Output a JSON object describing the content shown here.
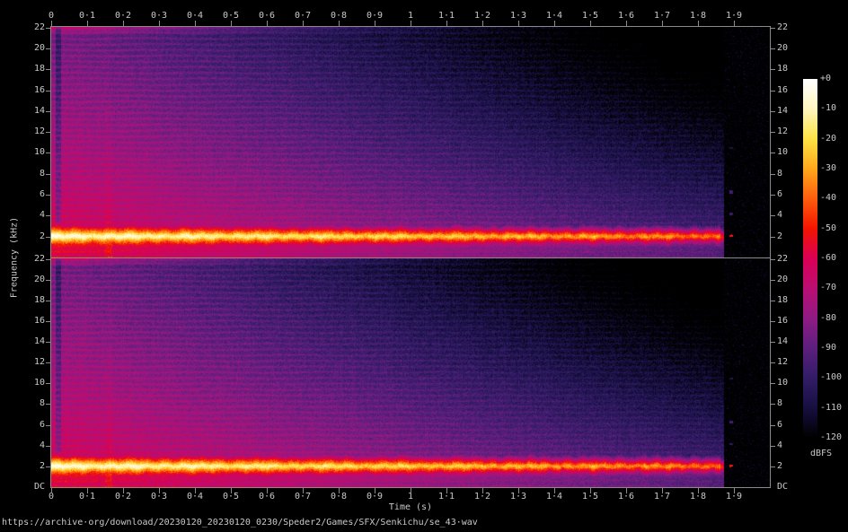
{
  "source_url": "https://archive·org/download/20230120_20230120_0230/Speder2/Games/SFX/Senkichu/se_43·wav",
  "axes": {
    "time": {
      "label": "Time (s)",
      "tick_labels": [
        "0",
        "0·1",
        "0·2",
        "0·3",
        "0·4",
        "0·5",
        "0·6",
        "0·7",
        "0·8",
        "0·9",
        "1",
        "1·1",
        "1·2",
        "1·3",
        "1·4",
        "1·5",
        "1·6",
        "1·7",
        "1·8",
        "1·9"
      ]
    },
    "frequency": {
      "label": "Frequency (kHz)",
      "tick_labels": [
        "22",
        "20",
        "18",
        "16",
        "14",
        "12",
        "10",
        "8",
        "6",
        "4",
        "2"
      ],
      "dc_label": "DC"
    },
    "colorbar": {
      "label": "dBFS",
      "tick_labels": [
        "+0",
        "-10",
        "-20",
        "-30",
        "-40",
        "-50",
        "-60",
        "-70",
        "-80",
        "-90",
        "-100",
        "-110",
        "-120"
      ]
    }
  },
  "chart_data": {
    "type": "heatmap",
    "subtype": "stereo audio spectrogram, two stacked channel panels (SoX style)",
    "x": {
      "label": "Time (s)",
      "range_s": [
        0,
        2.0
      ],
      "tick_step_s": 0.1
    },
    "y": {
      "label": "Frequency (kHz)",
      "range_khz_per_channel": [
        0,
        22.05
      ],
      "tick_step_khz": 2,
      "dc_at_bottom": true
    },
    "z": {
      "label": "dBFS",
      "range_db": [
        -120,
        0
      ],
      "tick_step_db": 10,
      "legend_position": "right colorbar"
    },
    "channels": 2,
    "features": {
      "dominant_tone_khz": 2.06,
      "dominant_tone_level_dbfs_start": -5,
      "dominant_tone_level_dbfs_end": -40,
      "signal_end_s": 1.87,
      "echo_dot_s": 1.89,
      "harmonic_stripe_spacing_khz": 0.55,
      "secondary_partial_khz": 6.3,
      "onset_attack_s": 0.0,
      "second_burst_s": 0.16,
      "broadband_floor_dbfs_at_start": -60,
      "broadband_floor_dbfs_at_end": -115,
      "top_edge_emphasis_khz": 22.0
    },
    "palette_stops": [
      [
        0.0,
        "#ffffff"
      ],
      [
        0.083,
        "#fff6c0"
      ],
      [
        0.167,
        "#ffe345"
      ],
      [
        0.25,
        "#ffa81c"
      ],
      [
        0.333,
        "#ff5e0d"
      ],
      [
        0.417,
        "#f21500"
      ],
      [
        0.5,
        "#da0055"
      ],
      [
        0.583,
        "#bb0e72"
      ],
      [
        0.667,
        "#8e1b84"
      ],
      [
        0.75,
        "#5c1f7e"
      ],
      [
        0.833,
        "#321c66"
      ],
      [
        0.917,
        "#160f40"
      ],
      [
        1.0,
        "#000000"
      ]
    ]
  }
}
